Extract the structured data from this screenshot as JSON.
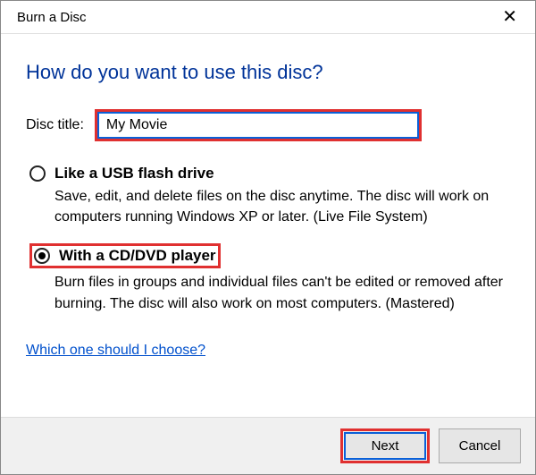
{
  "titlebar": {
    "title": "Burn a Disc"
  },
  "heading": "How do you want to use this disc?",
  "disc_title": {
    "label": "Disc title:",
    "value": "My Movie"
  },
  "options": {
    "usb": {
      "title": "Like a USB flash drive",
      "desc": "Save, edit, and delete files on the disc anytime. The disc will work on computers running Windows XP or later. (Live File System)",
      "checked": false
    },
    "cd": {
      "title": "With a CD/DVD player",
      "desc": "Burn files in groups and individual files can't be edited or removed after burning. The disc will also work on most computers. (Mastered)",
      "checked": true
    }
  },
  "help_link": "Which one should I choose?",
  "buttons": {
    "next": "Next",
    "cancel": "Cancel"
  }
}
